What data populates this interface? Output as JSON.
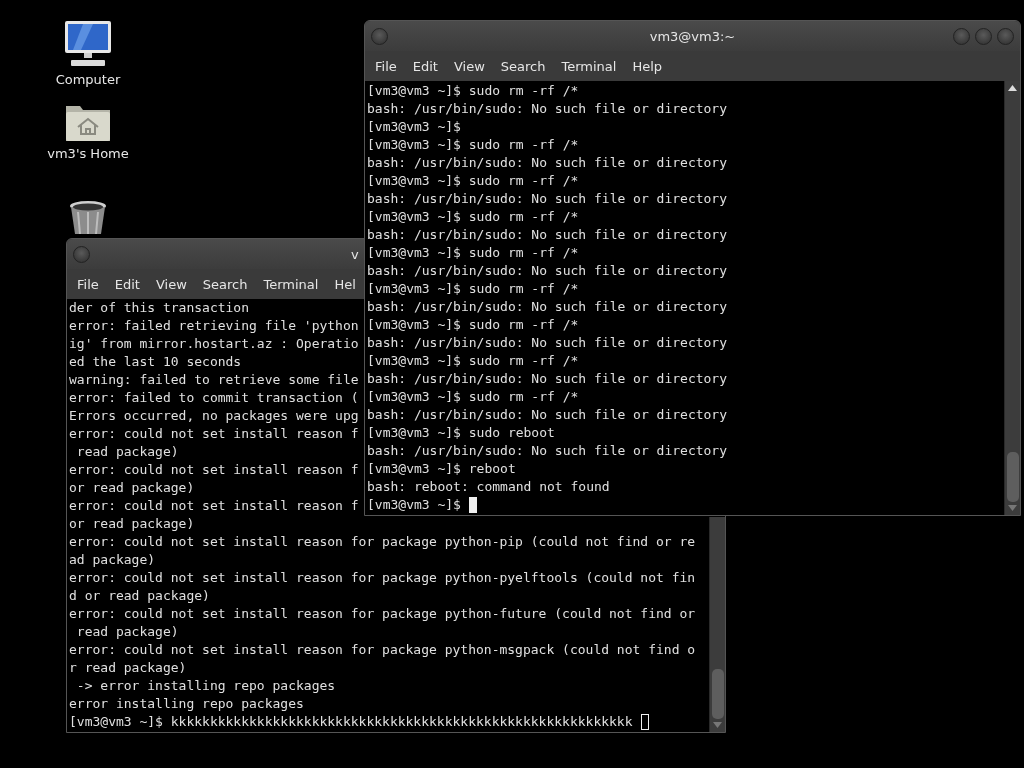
{
  "desktop": {
    "icons": [
      {
        "kind": "computer",
        "label": "Computer"
      },
      {
        "kind": "home",
        "label": "vm3's Home"
      },
      {
        "kind": "trash"
      }
    ]
  },
  "windows": [
    {
      "title": "v",
      "focused": false,
      "menu": [
        "File",
        "Edit",
        "View",
        "Search",
        "Terminal",
        "Hel"
      ],
      "lines": [
        "der of this transaction",
        "error: failed retrieving file 'python",
        "ig' from mirror.hostart.az : Operatio",
        "ed the last 10 seconds",
        "warning: failed to retrieve some file",
        "error: failed to commit transaction (",
        "Errors occurred, no packages were upg",
        "error: could not set install reason f",
        " read package)",
        "error: could not set install reason f",
        "or read package)",
        "error: could not set install reason f",
        "or read package)",
        "error: could not set install reason for package python-pip (could not find or re",
        "ad package)",
        "error: could not set install reason for package python-pyelftools (could not fin",
        "d or read package)",
        "error: could not set install reason for package python-future (could not find or",
        " read package)",
        "error: could not set install reason for package python-msgpack (could not find o",
        "r read package)",
        " -> error installing repo packages",
        "error installing repo packages",
        "[vm3@vm3 ~]$ kkkkkkkkkkkkkkkkkkkkkkkkkkkkkkkkkkkkkkkkkkkkkkkkkkkkkkkkkkk"
      ]
    },
    {
      "title": "vm3@vm3:~",
      "focused": true,
      "menu": [
        "File",
        "Edit",
        "View",
        "Search",
        "Terminal",
        "Help"
      ],
      "lines": [
        "[vm3@vm3 ~]$ sudo rm -rf /*",
        "bash: /usr/bin/sudo: No such file or directory",
        "[vm3@vm3 ~]$",
        "[vm3@vm3 ~]$ sudo rm -rf /*",
        "bash: /usr/bin/sudo: No such file or directory",
        "[vm3@vm3 ~]$ sudo rm -rf /*",
        "bash: /usr/bin/sudo: No such file or directory",
        "[vm3@vm3 ~]$ sudo rm -rf /*",
        "bash: /usr/bin/sudo: No such file or directory",
        "[vm3@vm3 ~]$ sudo rm -rf /*",
        "bash: /usr/bin/sudo: No such file or directory",
        "[vm3@vm3 ~]$ sudo rm -rf /*",
        "bash: /usr/bin/sudo: No such file or directory",
        "[vm3@vm3 ~]$ sudo rm -rf /*",
        "bash: /usr/bin/sudo: No such file or directory",
        "[vm3@vm3 ~]$ sudo rm -rf /*",
        "bash: /usr/bin/sudo: No such file or directory",
        "[vm3@vm3 ~]$ sudo rm -rf /*",
        "bash: /usr/bin/sudo: No such file or directory",
        "[vm3@vm3 ~]$ sudo reboot",
        "bash: /usr/bin/sudo: No such file or directory",
        "[vm3@vm3 ~]$ reboot",
        "bash: reboot: command not found",
        "[vm3@vm3 ~]$"
      ]
    }
  ]
}
